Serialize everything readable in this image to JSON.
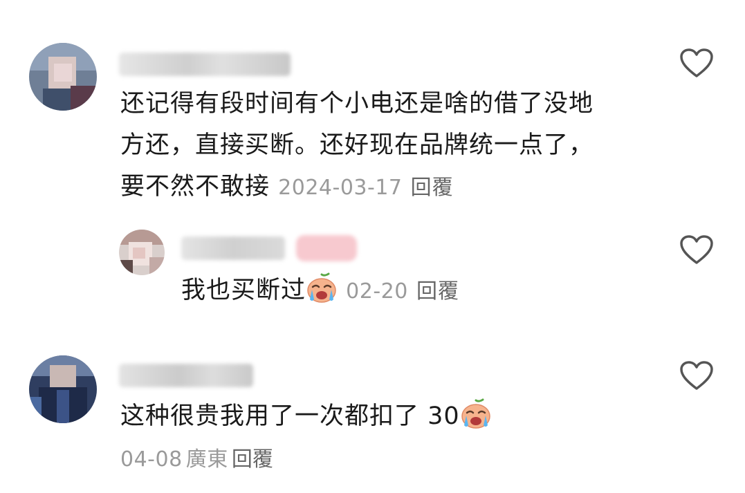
{
  "comments": [
    {
      "username": "",
      "text_lines": [
        "还记得有段时间有个小电还是啥的借了没地",
        "方还，直接买断。还好现在品牌统一点了，",
        "要不然不敢接"
      ],
      "date": "2024-03-17",
      "reply_label": "回覆",
      "liked": false,
      "avatar": "blurred-profile-photo",
      "replies": [
        {
          "username": "",
          "badge": "",
          "text": "我也买断过",
          "emoji": "crying-face-emoji",
          "date": "02-20",
          "reply_label": "回覆",
          "liked": false,
          "avatar": "blurred-profile-photo"
        }
      ]
    },
    {
      "username": "",
      "text": "这种很贵我用了一次都扣了 30",
      "emoji": "crying-face-emoji",
      "date": "04-08",
      "location": "廣東",
      "reply_label": "回覆",
      "liked": false,
      "avatar": "blurred-profile-photo"
    }
  ],
  "colors": {
    "text": "#1a1a1a",
    "meta": "#9a9a9a",
    "heart_outline": "#555555",
    "badge_pink": "#f7c9cf"
  }
}
